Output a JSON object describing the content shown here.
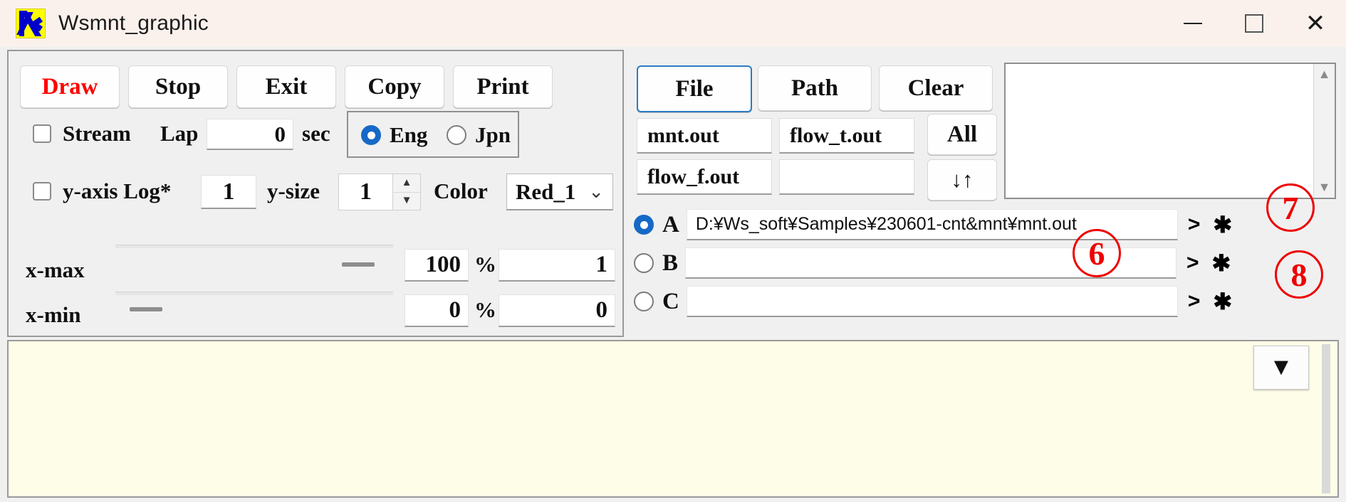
{
  "window": {
    "title": "Wsmnt_graphic",
    "logo_icon": "wsmnt-logo-icon",
    "minimize_label": "minimize-icon",
    "maximize_label": "maximize-icon",
    "close_label": "✕"
  },
  "toolbar": {
    "buttons": [
      {
        "label": "Draw",
        "color": "#ff0000"
      },
      {
        "label": "Stop",
        "color": "#101010"
      },
      {
        "label": "Exit",
        "color": "#101010"
      },
      {
        "label": "Copy",
        "color": "#101010"
      },
      {
        "label": "Print",
        "color": "#101010"
      }
    ]
  },
  "options": {
    "stream_label": "Stream",
    "stream_checked": false,
    "lap_label": "Lap",
    "lap_value": "0",
    "sec_label": "sec",
    "language": {
      "eng_label": "Eng",
      "jpn_label": "Jpn",
      "selected": "Eng"
    },
    "yaxis_log_label": "y-axis Log*",
    "yaxis_log_checked": false,
    "yaxis_log_value": "1",
    "ysize_label": "y-size",
    "ysize_value": "1",
    "color_label": "Color",
    "color_value": "Red_1",
    "color_chevron": "⌄"
  },
  "ranges": {
    "xmax_label": "x-max",
    "xmax_percent": "100",
    "xmax_percent_unit": "%",
    "xmax_value": "1",
    "xmin_label": "x-min",
    "xmin_percent": "0",
    "xmin_percent_unit": "%",
    "xmin_value": "0"
  },
  "files": {
    "tabs": [
      {
        "label": "File",
        "focused": true
      },
      {
        "label": "Path",
        "focused": false
      },
      {
        "label": "Clear",
        "focused": false
      }
    ],
    "entries": [
      "mnt.out",
      "flow_t.out",
      "flow_f.out",
      ""
    ],
    "all_label": "All",
    "sort_label": "↓↑",
    "list_items": [],
    "scroll_up": "▲",
    "scroll_down": "▼"
  },
  "paths": [
    {
      "key": "A",
      "selected": true,
      "value": "D:¥Ws_soft¥Samples¥230601-cnt&mnt¥mnt.out",
      "browse": ">",
      "star": "✱"
    },
    {
      "key": "B",
      "selected": false,
      "value": "",
      "browse": ">",
      "star": "✱"
    },
    {
      "key": "C",
      "selected": false,
      "value": "",
      "browse": ">",
      "star": "✱"
    }
  ],
  "plot": {
    "background": "#fdfde8",
    "dropdown_icon": "▼"
  },
  "annotations": [
    {
      "text": "7"
    },
    {
      "text": "6"
    },
    {
      "text": "8"
    }
  ]
}
